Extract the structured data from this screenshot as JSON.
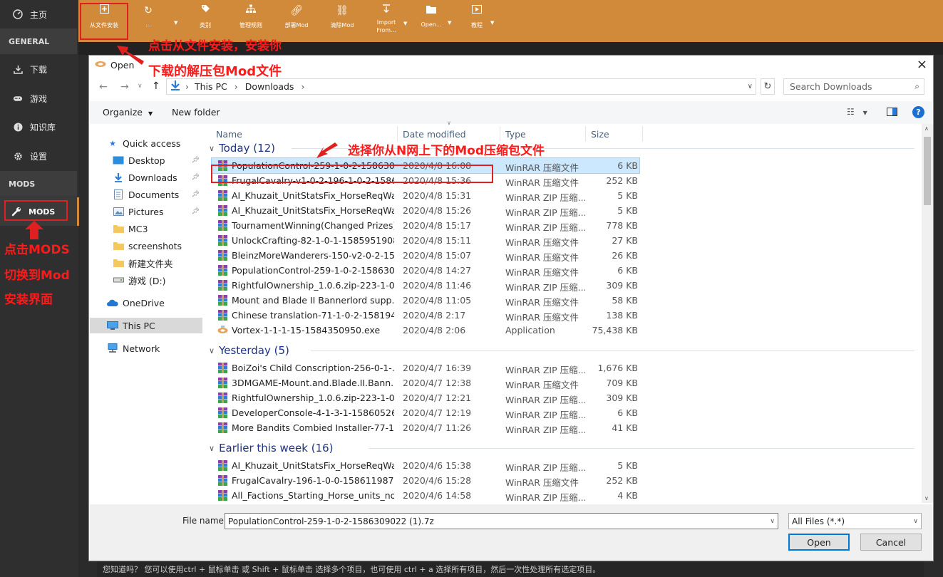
{
  "sidebar": {
    "home_label": "主页",
    "general_header": "GENERAL",
    "items": [
      {
        "label": "下载",
        "icon": "download-icon"
      },
      {
        "label": "游戏",
        "icon": "gamepad-icon"
      },
      {
        "label": "知识库",
        "icon": "info-icon"
      },
      {
        "label": "设置",
        "icon": "gear-icon"
      }
    ],
    "mods_header": "MODS",
    "mods_label": "MODS"
  },
  "toolbar": {
    "items": [
      {
        "label": "从文件安装",
        "icon": "plus-icon"
      },
      {
        "label": "...",
        "icon": "refresh-icon"
      },
      {
        "label": "类别",
        "icon": "tag-icon"
      },
      {
        "label": "管理规则",
        "icon": "rules-icon"
      },
      {
        "label": "部署Mod",
        "icon": "link-icon"
      },
      {
        "label": "清除Mod",
        "icon": "unlink-icon"
      },
      {
        "label": "Import From...",
        "icon": "import-icon"
      },
      {
        "label": "Open...",
        "icon": "folder-icon"
      },
      {
        "label": "教程",
        "icon": "video-icon"
      }
    ]
  },
  "dialog": {
    "title": "Open",
    "close": "×",
    "breadcrumb": [
      "This PC",
      "Downloads"
    ],
    "search_placeholder": "Search Downloads",
    "organize_label": "Organize",
    "new_folder_label": "New folder",
    "help": "?",
    "nav": [
      {
        "label": "Quick access",
        "icon": "star-icon"
      },
      {
        "label": "Desktop",
        "icon": "desktop-icon",
        "pinned": true
      },
      {
        "label": "Downloads",
        "icon": "download-arrow-icon",
        "pinned": true
      },
      {
        "label": "Documents",
        "icon": "document-icon",
        "pinned": true
      },
      {
        "label": "Pictures",
        "icon": "picture-icon",
        "pinned": true
      },
      {
        "label": "MC3",
        "icon": "folder-icon"
      },
      {
        "label": "screenshots",
        "icon": "folder-icon"
      },
      {
        "label": "新建文件夹",
        "icon": "folder-icon"
      },
      {
        "label": "游戏 (D:)",
        "icon": "drive-icon"
      },
      {
        "label": "OneDrive",
        "icon": "cloud-icon"
      },
      {
        "label": "This PC",
        "icon": "computer-icon"
      },
      {
        "label": "Network",
        "icon": "network-icon"
      }
    ],
    "columns": {
      "name": "Name",
      "date": "Date modified",
      "type": "Type",
      "size": "Size"
    },
    "groups": [
      {
        "label": "Today (12)",
        "files": [
          {
            "name": "PopulationControl-259-1-0-2-158630...",
            "date": "2020/4/8 16:08",
            "type": "WinRAR 压缩文件",
            "size": "6 KB",
            "icon": "winrar-icon"
          },
          {
            "name": "FrugalCavalry-v1-0-2-196-1-0-2-1586...",
            "date": "2020/4/8 15:36",
            "type": "WinRAR 压缩文件",
            "size": "252 KB",
            "icon": "winrar-icon"
          },
          {
            "name": "AI_Khuzait_UnitStatsFix_HorseReqWai...",
            "date": "2020/4/8 15:31",
            "type": "WinRAR ZIP 压缩...",
            "size": "5 KB",
            "icon": "winrar-icon"
          },
          {
            "name": "AI_Khuzait_UnitStatsFix_HorseReqWai...",
            "date": "2020/4/8 15:26",
            "type": "WinRAR ZIP 压缩...",
            "size": "5 KB",
            "icon": "winrar-icon"
          },
          {
            "name": "TournamentWinning(Changed Prizes)...",
            "date": "2020/4/8 15:17",
            "type": "WinRAR ZIP 压缩...",
            "size": "778 KB",
            "icon": "winrar-icon"
          },
          {
            "name": "UnlockCrafting-82-1-0-1-1585951908...",
            "date": "2020/4/8 15:11",
            "type": "WinRAR 压缩文件",
            "size": "27 KB",
            "icon": "winrar-icon"
          },
          {
            "name": "BleinzMoreWanderers-150-v2-0-2-15...",
            "date": "2020/4/8 15:07",
            "type": "WinRAR 压缩文件",
            "size": "26 KB",
            "icon": "winrar-icon"
          },
          {
            "name": "PopulationControl-259-1-0-2-158630...",
            "date": "2020/4/8 14:27",
            "type": "WinRAR 压缩文件",
            "size": "6 KB",
            "icon": "winrar-icon"
          },
          {
            "name": "RightfulOwnership_1.0.6.zip-223-1-0-...",
            "date": "2020/4/8 11:46",
            "type": "WinRAR ZIP 压缩...",
            "size": "309 KB",
            "icon": "winrar-icon"
          },
          {
            "name": "Mount and Blade II Bannerlord supp...",
            "date": "2020/4/8 11:05",
            "type": "WinRAR 压缩文件",
            "size": "58 KB",
            "icon": "winrar-icon"
          },
          {
            "name": "Chinese translation-71-1-0-2-158194...",
            "date": "2020/4/8 2:17",
            "type": "WinRAR 压缩文件",
            "size": "138 KB",
            "icon": "winrar-icon"
          },
          {
            "name": "Vortex-1-1-1-15-1584350950.exe",
            "date": "2020/4/8 2:06",
            "type": "Application",
            "size": "75,438 KB",
            "icon": "vortex-icon"
          }
        ]
      },
      {
        "label": "Yesterday (5)",
        "files": [
          {
            "name": "BoiZoi's Child Conscription-256-0-1-...",
            "date": "2020/4/7 16:39",
            "type": "WinRAR ZIP 压缩...",
            "size": "1,676 KB",
            "icon": "winrar-icon"
          },
          {
            "name": "3DMGAME-Mount.and.Blade.II.Bann...",
            "date": "2020/4/7 12:38",
            "type": "WinRAR 压缩文件",
            "size": "709 KB",
            "icon": "winrar-icon"
          },
          {
            "name": "RightfulOwnership_1.0.6.zip-223-1-0-...",
            "date": "2020/4/7 12:21",
            "type": "WinRAR ZIP 压缩...",
            "size": "309 KB",
            "icon": "winrar-icon"
          },
          {
            "name": "DeveloperConsole-4-1-3-1-15860526...",
            "date": "2020/4/7 12:19",
            "type": "WinRAR ZIP 压缩...",
            "size": "6 KB",
            "icon": "winrar-icon"
          },
          {
            "name": "More Bandits Combied Installer-77-1...",
            "date": "2020/4/7 11:26",
            "type": "WinRAR ZIP 压缩...",
            "size": "41 KB",
            "icon": "winrar-icon"
          }
        ]
      },
      {
        "label": "Earlier this week (16)",
        "files": [
          {
            "name": "AI_Khuzait_UnitStatsFix_HorseReqWai...",
            "date": "2020/4/6 15:38",
            "type": "WinRAR ZIP 压缩...",
            "size": "5 KB",
            "icon": "winrar-icon"
          },
          {
            "name": "FrugalCavalry-196-1-0-0-1586119870...",
            "date": "2020/4/6 15:28",
            "type": "WinRAR 压缩文件",
            "size": "252 KB",
            "icon": "winrar-icon"
          },
          {
            "name": "All_Factions_Starting_Horse_units_no_l...",
            "date": "2020/4/6 14:58",
            "type": "WinRAR ZIP 压缩...",
            "size": "4 KB",
            "icon": "winrar-icon"
          }
        ]
      }
    ],
    "filename_label": "File name:",
    "filename_value": "PopulationControl-259-1-0-2-1586309022 (1).7z",
    "filter_value": "All Files (*.*)",
    "open_label": "Open",
    "cancel_label": "Cancel"
  },
  "status_tip": "您知道吗？ 您可以使用ctrl + 鼠标单击 或 Shift + 鼠标单击 选择多个项目，也可使用 ctrl + a 选择所有项目，然后一次性处理所有选定项目。",
  "annotations": {
    "a1": "点击从文件安装，安装你",
    "a2": "下载的解压包Mod文件",
    "a3": "选择你从N网上下的Mod压缩包文件",
    "a4": "点击MODS",
    "a5": "切换到Mod",
    "a6": "安装界面"
  },
  "colors": {
    "toolbar": "#d08a39",
    "sidebar": "#2f2f2f",
    "annotation": "#ff1a1a",
    "selection": "#cce8ff"
  }
}
